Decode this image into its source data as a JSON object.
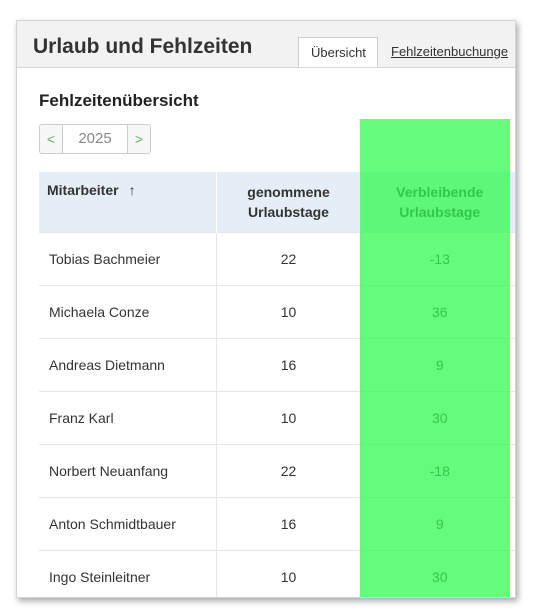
{
  "header": {
    "title": "Urlaub und Fehlzeiten",
    "tabs": [
      "Übersicht",
      "Fehlzeitenbuchunge"
    ]
  },
  "section_title": "Fehlzeitenübersicht",
  "year_nav": {
    "prev": "<",
    "year": "2025",
    "next": ">"
  },
  "table": {
    "headers": {
      "name": "Mitarbeiter",
      "sort_indicator": "↑",
      "taken": "genommene Urlaubstage",
      "remaining": "Verbleibende Urlaubstage"
    },
    "rows": [
      {
        "name": "Tobias Bachmeier",
        "taken": "22",
        "remaining": "-13"
      },
      {
        "name": "Michaela Conze",
        "taken": "10",
        "remaining": "36"
      },
      {
        "name": "Andreas Dietmann",
        "taken": "16",
        "remaining": "9"
      },
      {
        "name": "Franz Karl",
        "taken": "10",
        "remaining": "30"
      },
      {
        "name": "Norbert Neuanfang",
        "taken": "22",
        "remaining": "-18"
      },
      {
        "name": "Anton Schmidtbauer",
        "taken": "16",
        "remaining": "9"
      },
      {
        "name": "Ingo Steinleitner",
        "taken": "10",
        "remaining": "30"
      }
    ]
  },
  "colors": {
    "highlight": "#32fa50",
    "header_bg": "#e5eef7",
    "nav_accent": "#5cb85c"
  }
}
